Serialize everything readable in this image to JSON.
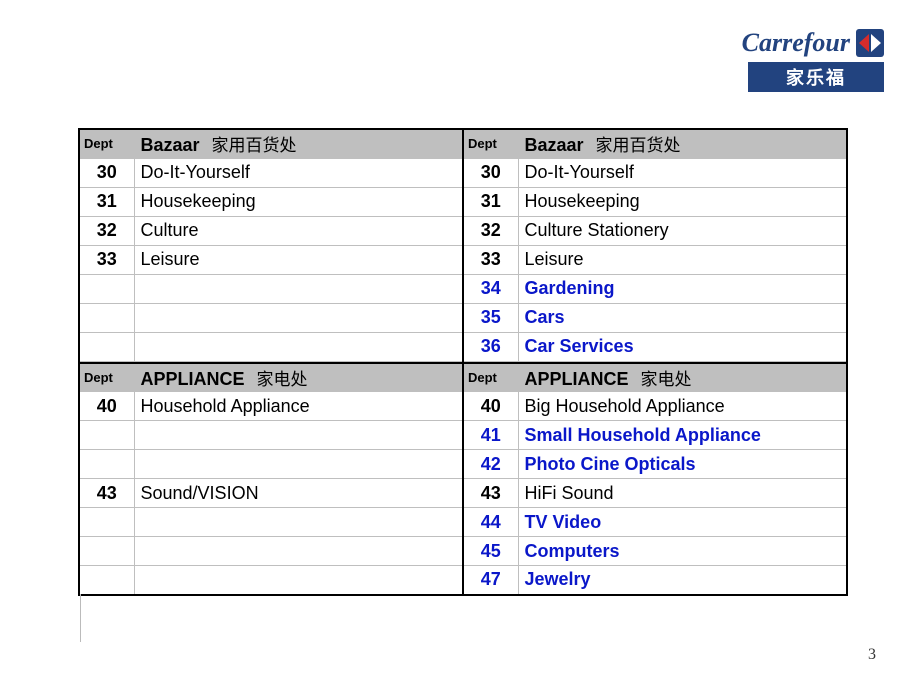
{
  "brand": {
    "name": "Carrefour",
    "cn": "家乐福"
  },
  "page_number": "3",
  "labels": {
    "dept": "Dept"
  },
  "sections": [
    {
      "title_en": "Bazaar",
      "title_cn": "家用百货处",
      "left": [
        {
          "code": "30",
          "name": "Do-It-Yourself"
        },
        {
          "code": "31",
          "name": "Housekeeping"
        },
        {
          "code": "32",
          "name": "Culture"
        },
        {
          "code": "33",
          "name": "Leisure"
        },
        {
          "code": "",
          "name": ""
        },
        {
          "code": "",
          "name": ""
        },
        {
          "code": "",
          "name": ""
        }
      ],
      "right": [
        {
          "code": "30",
          "name": "Do-It-Yourself"
        },
        {
          "code": "31",
          "name": "Housekeeping"
        },
        {
          "code": "32",
          "name": "Culture Stationery"
        },
        {
          "code": "33",
          "name": "Leisure"
        },
        {
          "code": "34",
          "name": "Gardening",
          "hi": true
        },
        {
          "code": "35",
          "name": "Cars",
          "hi": true
        },
        {
          "code": "36",
          "name": "Car Services",
          "hi": true
        }
      ]
    },
    {
      "title_en": "APPLIANCE",
      "title_cn": "家电处",
      "left": [
        {
          "code": "40",
          "name": "Household Appliance"
        },
        {
          "code": "",
          "name": ""
        },
        {
          "code": "",
          "name": ""
        },
        {
          "code": "43",
          "name": "Sound/VISION"
        },
        {
          "code": "",
          "name": ""
        },
        {
          "code": "",
          "name": ""
        },
        {
          "code": "",
          "name": ""
        }
      ],
      "right": [
        {
          "code": "40",
          "name": "Big Household Appliance"
        },
        {
          "code": "41",
          "name": "Small Household Appliance",
          "hi": true
        },
        {
          "code": "42",
          "name": "Photo Cine Opticals",
          "hi": true
        },
        {
          "code": "43",
          "name": "HiFi Sound"
        },
        {
          "code": "44",
          "name": "TV Video",
          "hi": true
        },
        {
          "code": "45",
          "name": "Computers",
          "hi": true
        },
        {
          "code": "47",
          "name": "Jewelry",
          "hi": true
        }
      ]
    }
  ]
}
